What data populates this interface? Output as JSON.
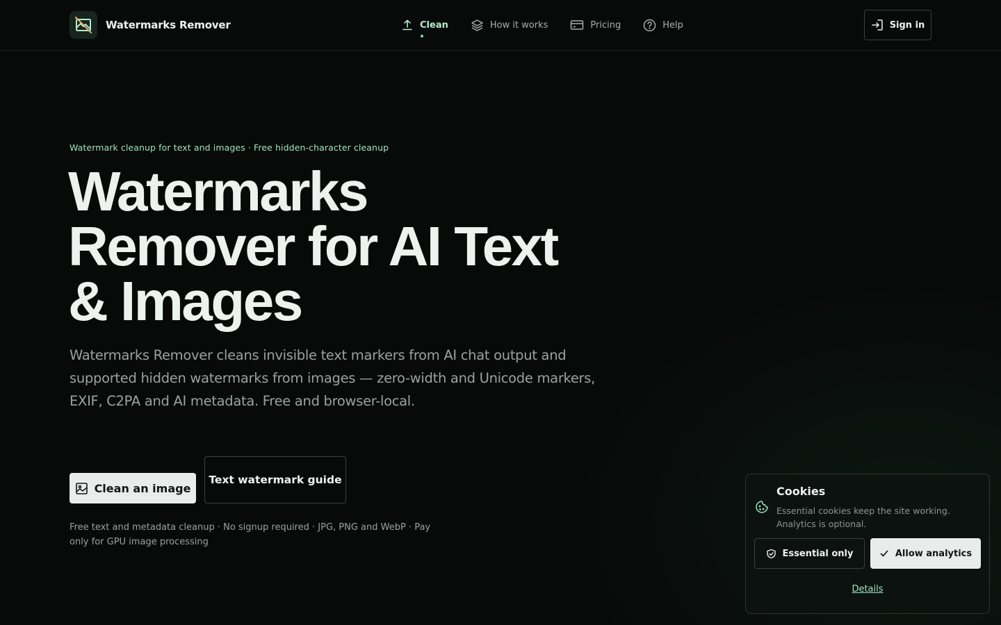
{
  "header": {
    "brand_name": "Watermarks Remover",
    "nav": [
      {
        "label": "Clean",
        "icon": "upload-icon",
        "active": true
      },
      {
        "label": "How it works",
        "icon": "layers-icon",
        "active": false
      },
      {
        "label": "Pricing",
        "icon": "credit-card-icon",
        "active": false
      },
      {
        "label": "Help",
        "icon": "help-circle-icon",
        "active": false
      }
    ],
    "sign_in_label": "Sign in"
  },
  "hero": {
    "eyebrow": "Watermark cleanup for text and images · Free hidden-character cleanup",
    "title": "Watermarks Remover for AI Text & Images",
    "lead": "Watermarks Remover cleans invisible text markers from AI chat output and supported hidden watermarks from images — zero-width and Unicode markers, EXIF, C2PA and AI metadata. Free and browser-local.",
    "primary_button": "Clean an image",
    "secondary_button": "Text watermark guide",
    "fineprint": "Free text and metadata cleanup · No signup required · JPG, PNG and WebP · Pay only for GPU image processing"
  },
  "cookie_banner": {
    "title": "Cookies",
    "text": "Essential cookies keep the site working. Analytics is optional.",
    "essential_button": "Essential only",
    "allow_button": "Allow analytics",
    "details_link": "Details"
  },
  "colors": {
    "background": "#070a09",
    "accent": "#9fe3c0",
    "text": "#eef2ef",
    "muted": "#9aa39e"
  }
}
